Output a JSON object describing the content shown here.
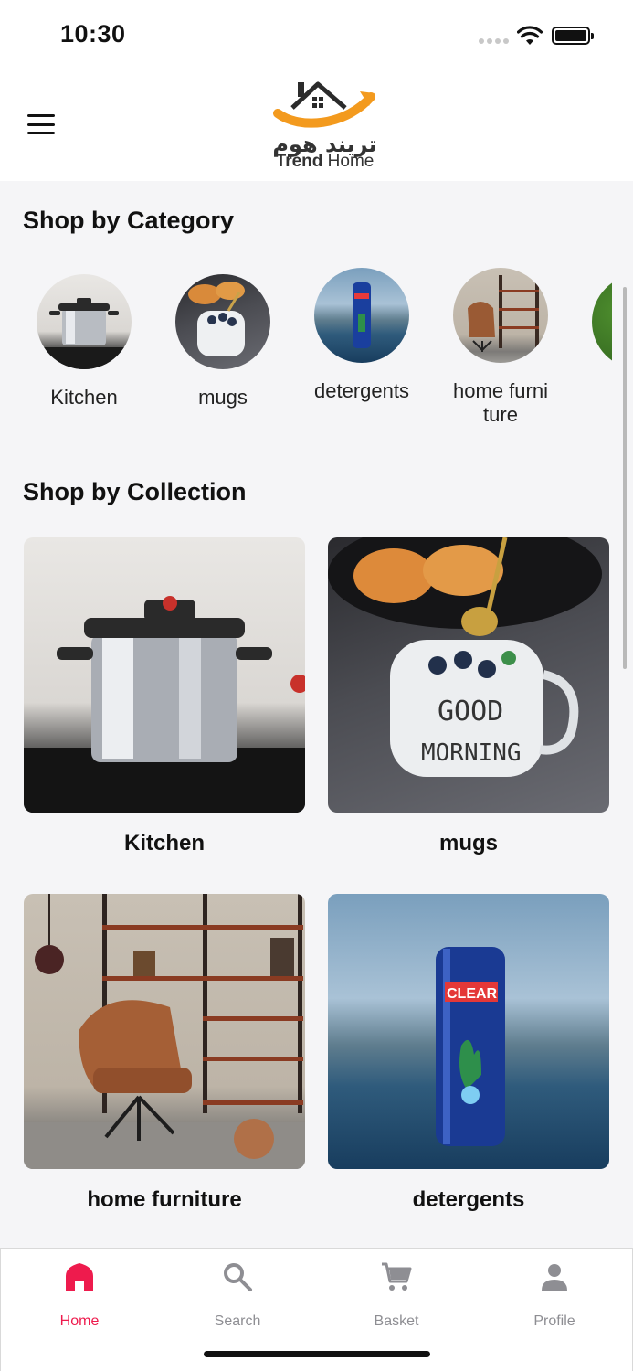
{
  "status_bar": {
    "time": "10:30"
  },
  "header": {
    "menu_icon": "hamburger-menu-icon",
    "logo": {
      "arabic": "تريند هوم",
      "english_bold": "Trend",
      "english_light": " Home"
    }
  },
  "categories": {
    "title": "Shop by Category",
    "items": [
      {
        "label": "Kitchen",
        "icon": "pressure-cooker"
      },
      {
        "label": "mugs",
        "icon": "mug"
      },
      {
        "label": "detergents",
        "icon": "shampoo-bottle"
      },
      {
        "label": "home furniture",
        "icon": "armchair"
      }
    ]
  },
  "collections": {
    "title": "Shop by Collection",
    "items": [
      {
        "label": "Kitchen"
      },
      {
        "label": "mugs"
      },
      {
        "label": "home furniture"
      },
      {
        "label": "detergents"
      }
    ]
  },
  "product_text": {
    "clear": "CLEAR",
    "mug_text_1": "GOOD",
    "mug_text_2": "MORNING"
  },
  "bottom_nav": {
    "active": "Home",
    "items": [
      {
        "label": "Home",
        "icon": "home-icon"
      },
      {
        "label": "Search",
        "icon": "search-icon"
      },
      {
        "label": "Basket",
        "icon": "cart-icon"
      },
      {
        "label": "Profile",
        "icon": "person-icon"
      }
    ]
  },
  "colors": {
    "accent": "#ee1b4d",
    "logo_orange": "#f39a1e",
    "inactive": "#8e8e93"
  }
}
